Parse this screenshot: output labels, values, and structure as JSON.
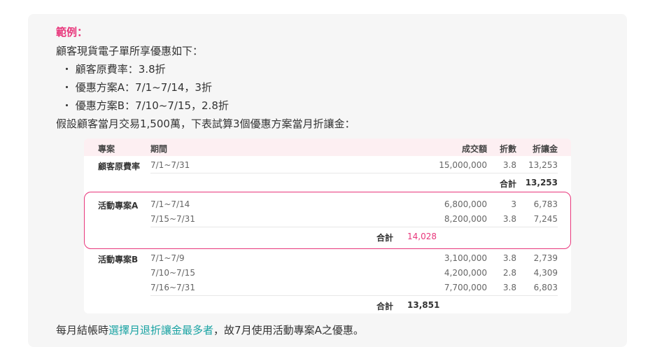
{
  "example": {
    "title": "範例：",
    "intro": "顧客現貨電子單所享優惠如下：",
    "bullets": [
      "顧客原費率：3.8折",
      "優惠方案A：7/1~7/14，3折",
      "優惠方案B：7/10~7/15，2.8折"
    ],
    "assumption": "假設顧客當月交易1,500萬，下表試算3個優惠方案當月折讓金："
  },
  "table": {
    "headers": {
      "plan": "專案",
      "period": "期間",
      "amount": "成交額",
      "discount": "折數",
      "rebate": "折讓金"
    },
    "groups": [
      {
        "name": "顧客原費率",
        "rows": [
          {
            "period": "7/1~7/31",
            "amount": "15,000,000",
            "discount": "3.8",
            "rebate": "13,253"
          }
        ],
        "total_label": "合計",
        "total": "13,253"
      },
      {
        "name": "活動專案A",
        "rows": [
          {
            "period": "7/1~7/14",
            "amount": "6,800,000",
            "discount": "3",
            "rebate": "6,783"
          },
          {
            "period": "7/15~7/31",
            "amount": "8,200,000",
            "discount": "3.8",
            "rebate": "7,245"
          }
        ],
        "total_label": "合計",
        "total": "14,028"
      },
      {
        "name": "活動專案B",
        "rows": [
          {
            "period": "7/1~7/9",
            "amount": "3,100,000",
            "discount": "3.8",
            "rebate": "2,739"
          },
          {
            "period": "7/10~7/15",
            "amount": "4,200,000",
            "discount": "2.8",
            "rebate": "4,309"
          },
          {
            "period": "7/16~7/31",
            "amount": "7,700,000",
            "discount": "3.8",
            "rebate": "6,803"
          }
        ],
        "total_label": "合計",
        "total": "13,851"
      }
    ]
  },
  "conclusion": {
    "before": "每月結帳時",
    "highlight": "選擇月退折讓金最多者",
    "after": "，故7月使用活動專案A之優惠。"
  },
  "colors": {
    "accent": "#e8367b",
    "highlight": "#1aa3a3",
    "header_bg": "#fdeff2"
  }
}
